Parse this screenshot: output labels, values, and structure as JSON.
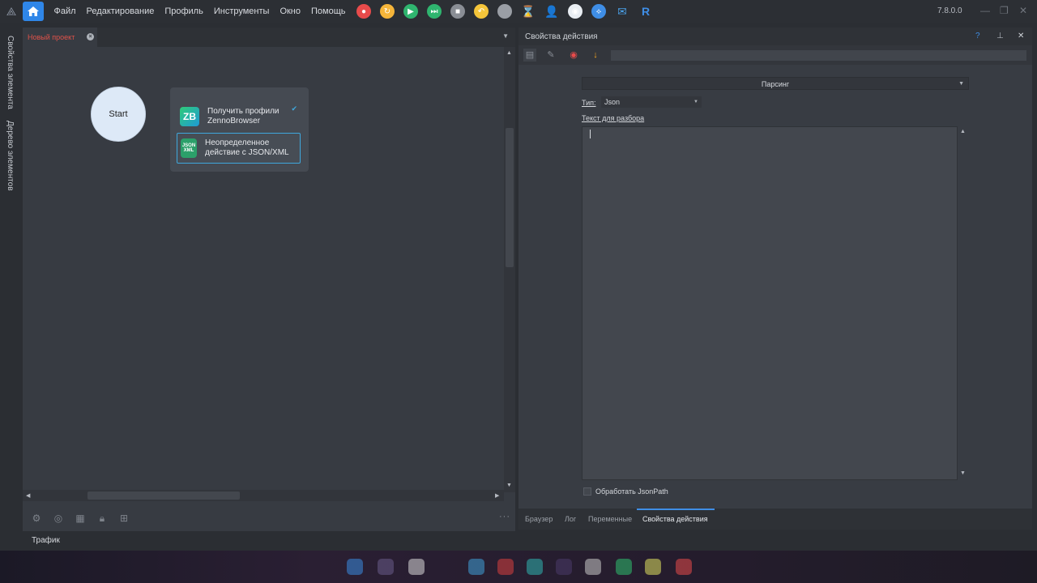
{
  "titlebar": {
    "menu": [
      "Файл",
      "Редактирование",
      "Профиль",
      "Инструменты",
      "Окно",
      "Помощь"
    ],
    "version": "7.8.0.0",
    "tool_icons": [
      {
        "name": "record-icon",
        "color": "#e84b4b",
        "glyph": "●"
      },
      {
        "name": "refresh-icon",
        "color": "#f5b53a",
        "glyph": "↻"
      },
      {
        "name": "play-icon",
        "color": "#2fb56f",
        "glyph": "▶"
      },
      {
        "name": "step-icon",
        "color": "#2fb56f",
        "glyph": "⏭"
      },
      {
        "name": "stop-icon",
        "color": "#8a8e95",
        "glyph": "■"
      },
      {
        "name": "undo-icon",
        "color": "#f5c53a",
        "glyph": "↶"
      },
      {
        "name": "circle-icon",
        "color": "#9a9ea5",
        "glyph": ""
      },
      {
        "name": "hourglass-icon",
        "color": "transparent",
        "glyph": "⌛"
      },
      {
        "name": "user-icon",
        "color": "transparent",
        "glyph": "👤"
      },
      {
        "name": "eye-icon",
        "color": "#e9eef3",
        "glyph": "◉"
      },
      {
        "name": "share-icon",
        "color": "#3f8ee6",
        "glyph": "⟡"
      },
      {
        "name": "mail-icon",
        "color": "transparent",
        "glyph": "✉"
      },
      {
        "name": "r-icon",
        "color": "transparent",
        "glyph": "R"
      }
    ]
  },
  "side_tabs": [
    "Свойства элемента",
    "Дерево элементов"
  ],
  "project": {
    "tab_title": "Новый проект",
    "start_label": "Start",
    "popup": {
      "item1": "Получить профили ZennoBrowser",
      "item1_icon": "ZB",
      "item2": "Неопределенное действие с JSON/XML",
      "item2_icon": "JSON XML"
    }
  },
  "action_panel": {
    "title": "Свойства действия",
    "help": "?",
    "mode": "Парсинг",
    "type_label": "Тип:",
    "type_value": "Json",
    "text_label": "Текст для разбора",
    "jsonpath_label": "Обработать JsonPath",
    "tabs": [
      "Браузер",
      "Лог",
      "Переменные",
      "Свойства действия"
    ],
    "active_tab": "Свойства действия"
  },
  "status": {
    "traffic": "Трафик"
  }
}
